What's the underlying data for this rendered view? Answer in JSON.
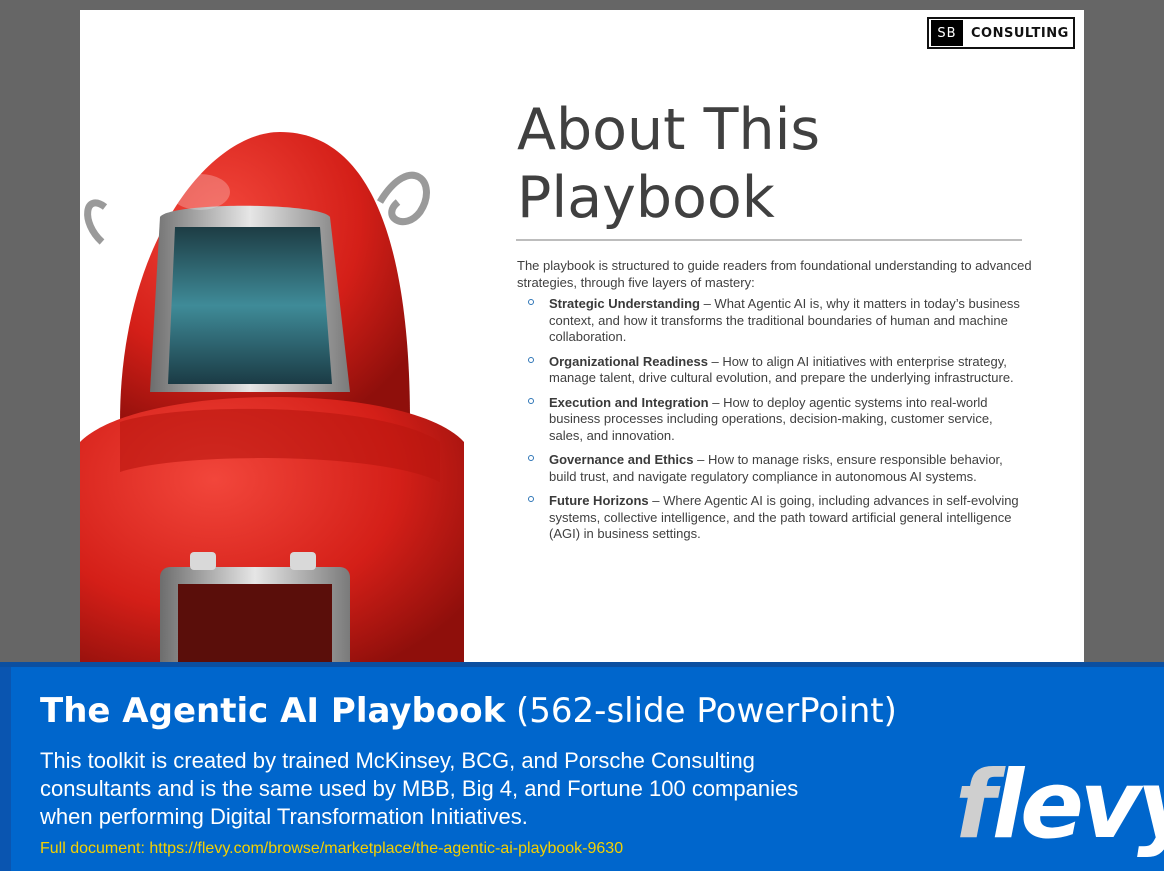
{
  "slide": {
    "logo": {
      "mark": "SB",
      "text": "CONSULTING"
    },
    "image": {
      "alt": "Red vintage toy robot"
    },
    "title_lines": [
      "About This",
      "Playbook"
    ],
    "intro": "The playbook is structured to guide readers from foundational understanding to advanced strategies, through five layers of mastery:",
    "bullets": [
      {
        "term": "Strategic Understanding",
        "text": " – What Agentic AI is, why it matters in today’s business context, and how it transforms the traditional boundaries of human and machine collaboration."
      },
      {
        "term": "Organizational Readiness",
        "text": " – How to align AI initiatives with enterprise strategy, manage talent, drive cultural evolution, and prepare the underlying infrastructure."
      },
      {
        "term": "Execution and Integration",
        "text": " – How to deploy agentic systems into real-world business processes including operations, decision-making, customer service, sales, and innovation."
      },
      {
        "term": "Governance and Ethics",
        "text": " – How to manage risks, ensure responsible behavior, build trust, and navigate regulatory compliance in autonomous AI systems."
      },
      {
        "term": "Future Horizons",
        "text": " – Where Agentic AI is going, including advances in self-evolving systems, collective intelligence, and the path toward artificial general intelligence (AGI) in business settings."
      }
    ]
  },
  "banner": {
    "title_bold": "The Agentic AI Playbook",
    "title_rest": " (562-slide PowerPoint)",
    "description": "This toolkit is created by trained McKinsey, BCG, and Porsche Consulting consultants and is the same used by MBB, Big 4, and Fortune 100 companies when performing Digital Transformation Initiatives.",
    "link_label": "Full document: ",
    "link_url": "https://flevy.com/browse/marketplace/the-agentic-ai-playbook-9630",
    "brand_f": "f",
    "brand_rest": "levy"
  },
  "colors": {
    "banner_bg": "#0066cc",
    "link": "#f5d000",
    "robot_red": "#d8231c",
    "bullet": "#2e75b6"
  }
}
